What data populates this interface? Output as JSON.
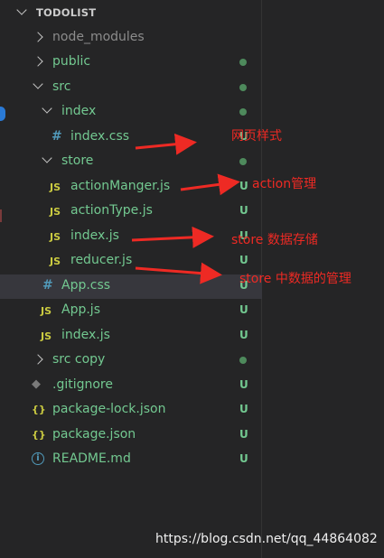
{
  "explorer": {
    "title": "TODOLIST",
    "items": [
      {
        "label": "node_modules",
        "kind": "folder",
        "open": false,
        "status": "",
        "color": "dim"
      },
      {
        "label": "public",
        "kind": "folder",
        "open": false,
        "status": "dot",
        "color": "g"
      },
      {
        "label": "src",
        "kind": "folder",
        "open": true,
        "status": "dot",
        "color": "g"
      },
      {
        "label": "index",
        "kind": "folder",
        "open": true,
        "status": "dot",
        "color": "g"
      },
      {
        "label": "index.css",
        "kind": "css",
        "status": "U",
        "color": "g"
      },
      {
        "label": "store",
        "kind": "folder",
        "open": true,
        "status": "dot",
        "color": "g"
      },
      {
        "label": "actionManger.js",
        "kind": "js",
        "status": "U",
        "color": "g"
      },
      {
        "label": "actionType.js",
        "kind": "js",
        "status": "U",
        "color": "g"
      },
      {
        "label": "index.js",
        "kind": "js",
        "status": "U",
        "color": "g"
      },
      {
        "label": "reducer.js",
        "kind": "js",
        "status": "U",
        "color": "g"
      },
      {
        "label": "App.css",
        "kind": "css",
        "status": "U",
        "color": "g"
      },
      {
        "label": "App.js",
        "kind": "js",
        "status": "U",
        "color": "g"
      },
      {
        "label": "index.js",
        "kind": "js",
        "status": "U",
        "color": "g"
      },
      {
        "label": "src copy",
        "kind": "folder",
        "open": false,
        "status": "dot",
        "color": "g"
      },
      {
        "label": ".gitignore",
        "kind": "git",
        "status": "U",
        "color": "g"
      },
      {
        "label": "package-lock.json",
        "kind": "json",
        "status": "U",
        "color": "g"
      },
      {
        "label": "package.json",
        "kind": "json",
        "status": "U",
        "color": "g"
      },
      {
        "label": "README.md",
        "kind": "info",
        "status": "U",
        "color": "g"
      }
    ]
  },
  "icons": {
    "js": "JS",
    "css": "#",
    "json": "{}",
    "git": "◆",
    "info": "i"
  },
  "annotations": {
    "note1": "网页样式",
    "note2": "action管理",
    "note3": "store 数据存储",
    "note4": "store  中数据的管理"
  },
  "watermark": "https://blog.csdn.net/qq_44864082",
  "colors": {
    "background": "#252526",
    "status_green": "#73c991",
    "annotation_red": "#ee2a24",
    "js_yellow": "#cbcb41",
    "css_blue": "#519aba"
  }
}
